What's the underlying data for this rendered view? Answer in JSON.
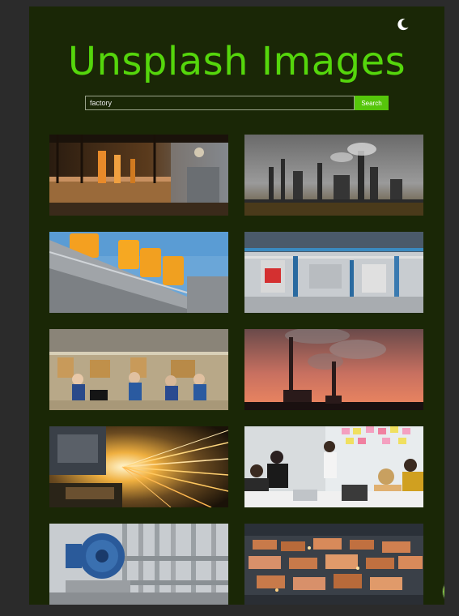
{
  "header": {
    "title": "Unsplash Images",
    "theme_icon": "moon-icon"
  },
  "search": {
    "value": "factory",
    "placeholder": "",
    "button_label": "Search"
  },
  "colors": {
    "accent": "#55d60c",
    "background": "#1a2706",
    "page": "#2b2b2b"
  },
  "images": [
    {
      "subject": "steel mill interior with orange glow"
    },
    {
      "subject": "oil refinery with smoking stacks"
    },
    {
      "subject": "yellow storage tanks on grey building"
    },
    {
      "subject": "industrial pipes and machinery hall"
    },
    {
      "subject": "workers on factory assembly line"
    },
    {
      "subject": "smokestacks at sunset"
    },
    {
      "subject": "sparks from metal cutting machine"
    },
    {
      "subject": "office meeting with sticky notes"
    },
    {
      "subject": "blue industrial pump with pipes"
    },
    {
      "subject": "container port aerial view"
    }
  ],
  "fab": {
    "icon": "landscape-icon"
  }
}
